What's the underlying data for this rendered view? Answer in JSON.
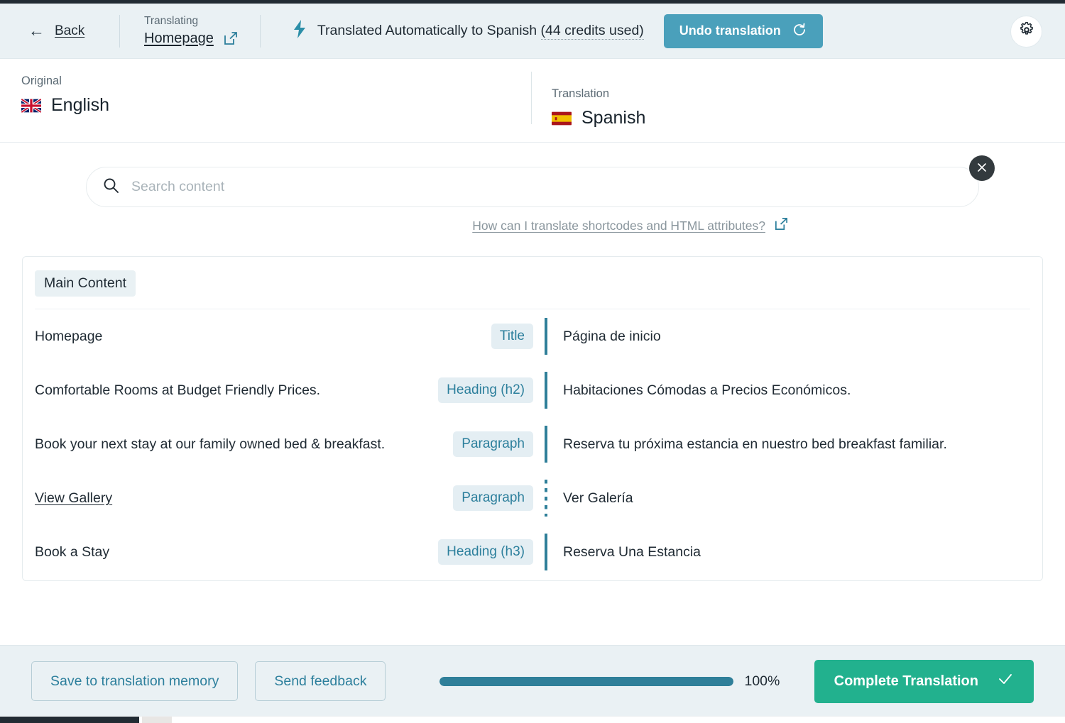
{
  "header": {
    "back_label": "Back",
    "translating_label": "Translating",
    "page_name": "Homepage",
    "external_link_icon": "external-link-icon",
    "bolt_icon": "lightning-bolt-icon",
    "status_prefix": "Translated Automatically to Spanish",
    "credits_text": "(44 credits used)",
    "undo_label": "Undo translation",
    "undo_icon": "undo-rotate-icon",
    "undo_color": "#4aa0bb",
    "gear_icon": "gear-icon",
    "accent_teal": "#2f7f99"
  },
  "languages": {
    "original_heading": "Original",
    "original_name": "English",
    "original_flag_icon": "uk-flag-icon",
    "translation_heading": "Translation",
    "translation_name": "Spanish",
    "translation_flag_icon": "spain-flag-icon"
  },
  "search": {
    "placeholder": "Search content",
    "value": "",
    "search_icon": "search-icon",
    "close_icon": "close-icon",
    "close_bg": "#333a3e",
    "help_text": "How can I translate shortcodes and HTML attributes?",
    "help_icon": "external-link-icon"
  },
  "card": {
    "section_label": "Main Content",
    "rows": [
      {
        "source": "Homepage",
        "type": "Title",
        "target": "Página de inicio",
        "divider": "solid",
        "is_link": false
      },
      {
        "source": "Comfortable Rooms at Budget Friendly Prices.",
        "type": "Heading (h2)",
        "target": "Habitaciones Cómodas a Precios Económicos.",
        "divider": "solid",
        "is_link": false
      },
      {
        "source": "Book your next stay at our family owned bed & breakfast.",
        "type": "Paragraph",
        "target": "Reserva tu próxima estancia en nuestro bed breakfast familiar.",
        "divider": "solid",
        "is_link": false
      },
      {
        "source": "View Gallery",
        "type": "Paragraph",
        "target": "Ver Galería",
        "divider": "dotted",
        "is_link": true
      },
      {
        "source": "Book a Stay",
        "type": "Heading (h3)",
        "target": "Reserva Una Estancia",
        "divider": "solid",
        "is_link": false
      }
    ]
  },
  "footer": {
    "save_label": "Save to translation memory",
    "feedback_label": "Send feedback",
    "progress_percent": 100,
    "progress_label": "100%",
    "progress_color": "#2f7f99",
    "complete_label": "Complete Translation",
    "complete_icon": "checkmark-icon",
    "complete_color": "#22b18e"
  }
}
